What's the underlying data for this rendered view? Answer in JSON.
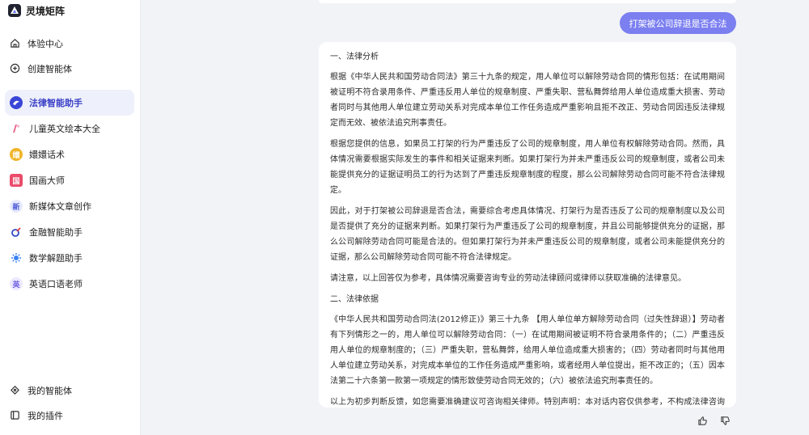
{
  "brand": {
    "name": "灵境矩阵"
  },
  "nav_top": [
    {
      "label": "体验中心",
      "icon": "home-icon"
    },
    {
      "label": "创建智能体",
      "icon": "plus-circle-icon"
    }
  ],
  "agents": [
    {
      "label": "法律智能助手",
      "badge": "",
      "color": "#3a46d6",
      "active": true
    },
    {
      "label": "儿童英文绘本大全",
      "badge": "",
      "color": "#e86a8f"
    },
    {
      "label": "嬛嬛话术",
      "badge": "嬛",
      "color": "#f0b429"
    },
    {
      "label": "国画大师",
      "badge": "国",
      "color": "#ea4c6a"
    },
    {
      "label": "新媒体文章创作",
      "badge": "新",
      "color": "#6d7ff2"
    },
    {
      "label": "金融智能助手",
      "badge": "",
      "color": "#2f49c9"
    },
    {
      "label": "数学解题助手",
      "badge": "",
      "color": "#3b82f6"
    },
    {
      "label": "英语口语老师",
      "badge": "英",
      "color": "#8e7cf0"
    }
  ],
  "nav_bottom": [
    {
      "label": "我的智能体",
      "icon": "agent-icon"
    },
    {
      "label": "我的插件",
      "icon": "plugin-icon"
    }
  ],
  "chat": {
    "user_message": "打架被公司辞退是否合法",
    "answer": {
      "h1": "一、法律分析",
      "p1": "根据《中华人民共和国劳动合同法》第三十九条的规定，用人单位可以解除劳动合同的情形包括：在试用期间被证明不符合录用条件、严重违反用人单位的规章制度、严重失职、营私舞弊给用人单位造成重大损害、劳动者同时与其他用人单位建立劳动关系对完成本单位工作任务造成严重影响且拒不改正、劳动合同因违反法律规定而无效、被依法追究刑事责任。",
      "p2": "根据您提供的信息，如果员工打架的行为严重违反了公司的规章制度，用人单位有权解除劳动合同。然而，具体情况需要根据实际发生的事件和相关证据来判断。如果打架行为并未严重违反公司的规章制度，或者公司未能提供充分的证据证明员工的行为达到了严重违反规章制度的程度，那么公司解除劳动合同可能不符合法律规定。",
      "p3": "因此，对于打架被公司辞退是否合法，需要综合考虑具体情况、打架行为是否违反了公司的规章制度以及公司是否提供了充分的证据来判断。如果打架行为严重违反了公司的规章制度，并且公司能够提供充分的证据，那么公司解除劳动合同可能是合法的。但如果打架行为并未严重违反公司的规章制度，或者公司未能提供充分的证据，那么公司解除劳动合同可能不符合法律规定。",
      "p4": "请注意，以上回答仅为参考，具体情况需要咨询专业的劳动法律顾问或律师以获取准确的法律意见。",
      "h2": "二、法律依据",
      "p5": "《中华人民共和国劳动合同法(2012修正)》第三十九条 【用人单位单方解除劳动合同（过失性辞退）】劳动者有下列情形之一的，用人单位可以解除劳动合同：（一）在试用期间被证明不符合录用条件的；（二）严重违反用人单位的规章制度的；（三）严重失职，营私舞弊，给用人单位造成重大损害的；（四）劳动者同时与其他用人单位建立劳动关系，对完成本单位的工作任务造成严重影响，或者经用人单位提出，拒不改正的；（五）因本法第二十六条第一款第一项规定的情形致使劳动合同无效的；（六）被依法追究刑事责任的。",
      "p6": "以上为初步判断反馈，如您需要准确建议可咨询相关律师。特别声明：本对话内容仅供参考，不构成法律咨询或建议，任何个案请咨询相关律师专业意见。"
    }
  },
  "feedback": {
    "like_icon": "thumb-up-icon",
    "dislike_icon": "thumb-down-icon"
  }
}
